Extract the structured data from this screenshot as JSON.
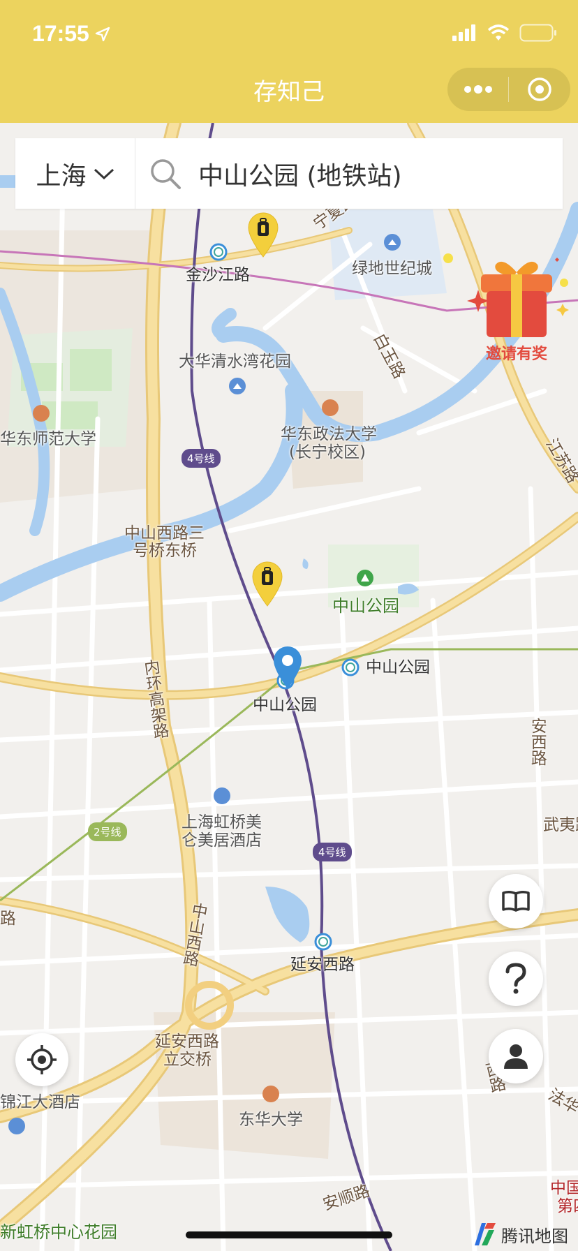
{
  "status_bar": {
    "time": "17:55"
  },
  "header": {
    "title": "存知己"
  },
  "search": {
    "city": "上海",
    "query": "中山公园 (地铁站)"
  },
  "map": {
    "labels": {
      "jinshajiang_road": "金沙江路",
      "ningxia_road": "宁夏路",
      "lvdi_world": "绿地世纪城",
      "baiyu_road": "白玉路",
      "dahua_garden": "大华清水湾花园",
      "ecnu": "华东师范大学",
      "ecupl_1": "华东政法大学",
      "ecupl_2": "(长宁校区)",
      "jiangsu_road": "江苏路",
      "zhongshan_bridge_1": "中山西路三",
      "zhongshan_bridge_2": "号桥东桥",
      "zhongshan_park_green": "中山公园",
      "zhongshan_park_station_l2": "中山公园",
      "zhongshan_park_station_l4": "中山公园",
      "inner_ring": "内环高架路",
      "anxi_road": "安西路",
      "hotel_1": "上海虹桥美",
      "hotel_2": "仑美居酒店",
      "wuyi_road": "武夷路",
      "yanan_west_road_station": "延安西路",
      "zhongshan_west_road": "中山西路",
      "yanan_interchange_1": "延安西路",
      "yanan_interchange_2": "立交桥",
      "jinjiang_hotel": "锦江大酒店",
      "dhu": "东华大学",
      "anshun_road": "安顺路",
      "xinhongqiao_garden": "新虹桥中心花园",
      "right_edge_1": "中国",
      "right_edge_2": "第四",
      "fahua": "法华",
      "left_edge_lu": "路",
      "fahua_road": "西路"
    },
    "line_tags": {
      "line4_a": "4号线",
      "line4_b": "4号线",
      "line2": "2号线"
    },
    "colors": {
      "line4": "#5f4c8c",
      "line2": "#9ab85a",
      "water": "#a9cdf0",
      "arterial": "#f7d98a",
      "marker": "#3a8fd9"
    }
  },
  "promo": {
    "gift_label": "邀请有奖"
  },
  "brand": {
    "name": "腾讯地图"
  },
  "icons": [
    "location-arrow-icon",
    "signal-icon",
    "wifi-icon",
    "battery-icon",
    "more-icon",
    "target-icon",
    "chevron-down-icon",
    "search-icon",
    "luggage-marker-icon",
    "location-pin-icon",
    "book-icon",
    "help-icon",
    "user-icon",
    "locate-icon",
    "gift-icon",
    "tencent-map-logo"
  ]
}
